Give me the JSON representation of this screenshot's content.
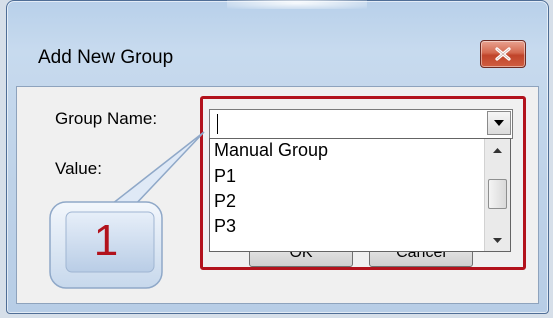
{
  "window": {
    "title": "Add New Group",
    "close_label": "close"
  },
  "form": {
    "group_name_label": "Group Name:",
    "value_label": "Value:",
    "group_name_value": ""
  },
  "dropdown": {
    "items": [
      "Manual Group",
      "P1",
      "P2",
      "P3"
    ]
  },
  "buttons": {
    "ok_label": "OK",
    "cancel_label": "Cancel"
  },
  "annotation": {
    "callout_number": "1",
    "highlight_color": "#b2121c"
  },
  "icons": {
    "close": "close-icon",
    "combo_arrow": "chevron-down-icon",
    "scroll_up": "scroll-up-icon",
    "scroll_down": "scroll-down-icon"
  }
}
